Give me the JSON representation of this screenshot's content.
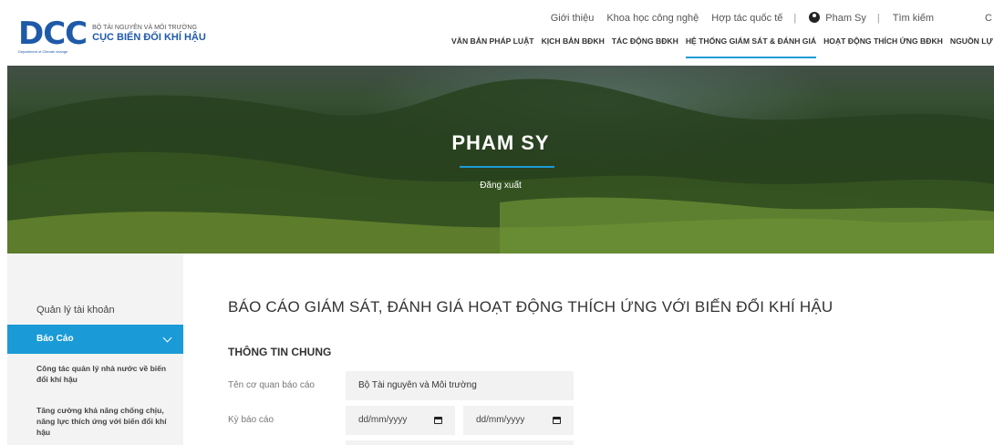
{
  "header": {
    "logo_mark": "DCC",
    "logo_sub": "Department of Climate change",
    "ministry": "BỘ TÀI NGUYÊN VÀ MÔI TRƯỜNG",
    "agency": "CỤC BIẾN ĐỔI KHÍ HẬU",
    "top_links": [
      "Giới thiệu",
      "Khoa học công nghệ",
      "Hợp tác quốc tế"
    ],
    "user_name": "Pham Sy",
    "search_label": "Tìm kiếm",
    "clipped_right": "C",
    "main_nav": [
      "VĂN BẢN PHÁP LUẬT",
      "KỊCH BẢN BĐKH",
      "TÁC ĐỘNG BĐKH",
      "HỆ THỐNG GIÁM SÁT & ĐÁNH GIÁ",
      "HOẠT ĐỘNG THÍCH ỨNG BĐKH",
      "NGUỒN LỰ"
    ]
  },
  "banner": {
    "title": "PHAM SY",
    "logout": "Đăng xuất"
  },
  "sidebar": {
    "account": "Quản lý tài khoản",
    "active": "Báo Cáo",
    "sub_items": [
      "Công tác quản lý nhà nước về biến đổi khí hậu",
      "Tăng cường khả năng chống chịu, năng lực thích ứng với biến đổi khí hậu"
    ]
  },
  "main": {
    "title": "BÁO CÁO GIÁM SÁT, ĐÁNH GIÁ HOẠT ĐỘNG THÍCH ỨNG VỚI BIẾN ĐỔI KHÍ HẬU",
    "section": "THÔNG TIN CHUNG",
    "fields": {
      "agency_label": "Tên cơ quan báo cáo",
      "agency_value": "Bộ Tài nguyên và Môi trường",
      "period_label": "Kỳ báo cáo",
      "date_from": "dd/mm/yyyy",
      "date_to": "dd/mm/yyyy"
    }
  },
  "colors": {
    "brand_blue": "#1e5aa8",
    "accent": "#1a9bd7"
  }
}
